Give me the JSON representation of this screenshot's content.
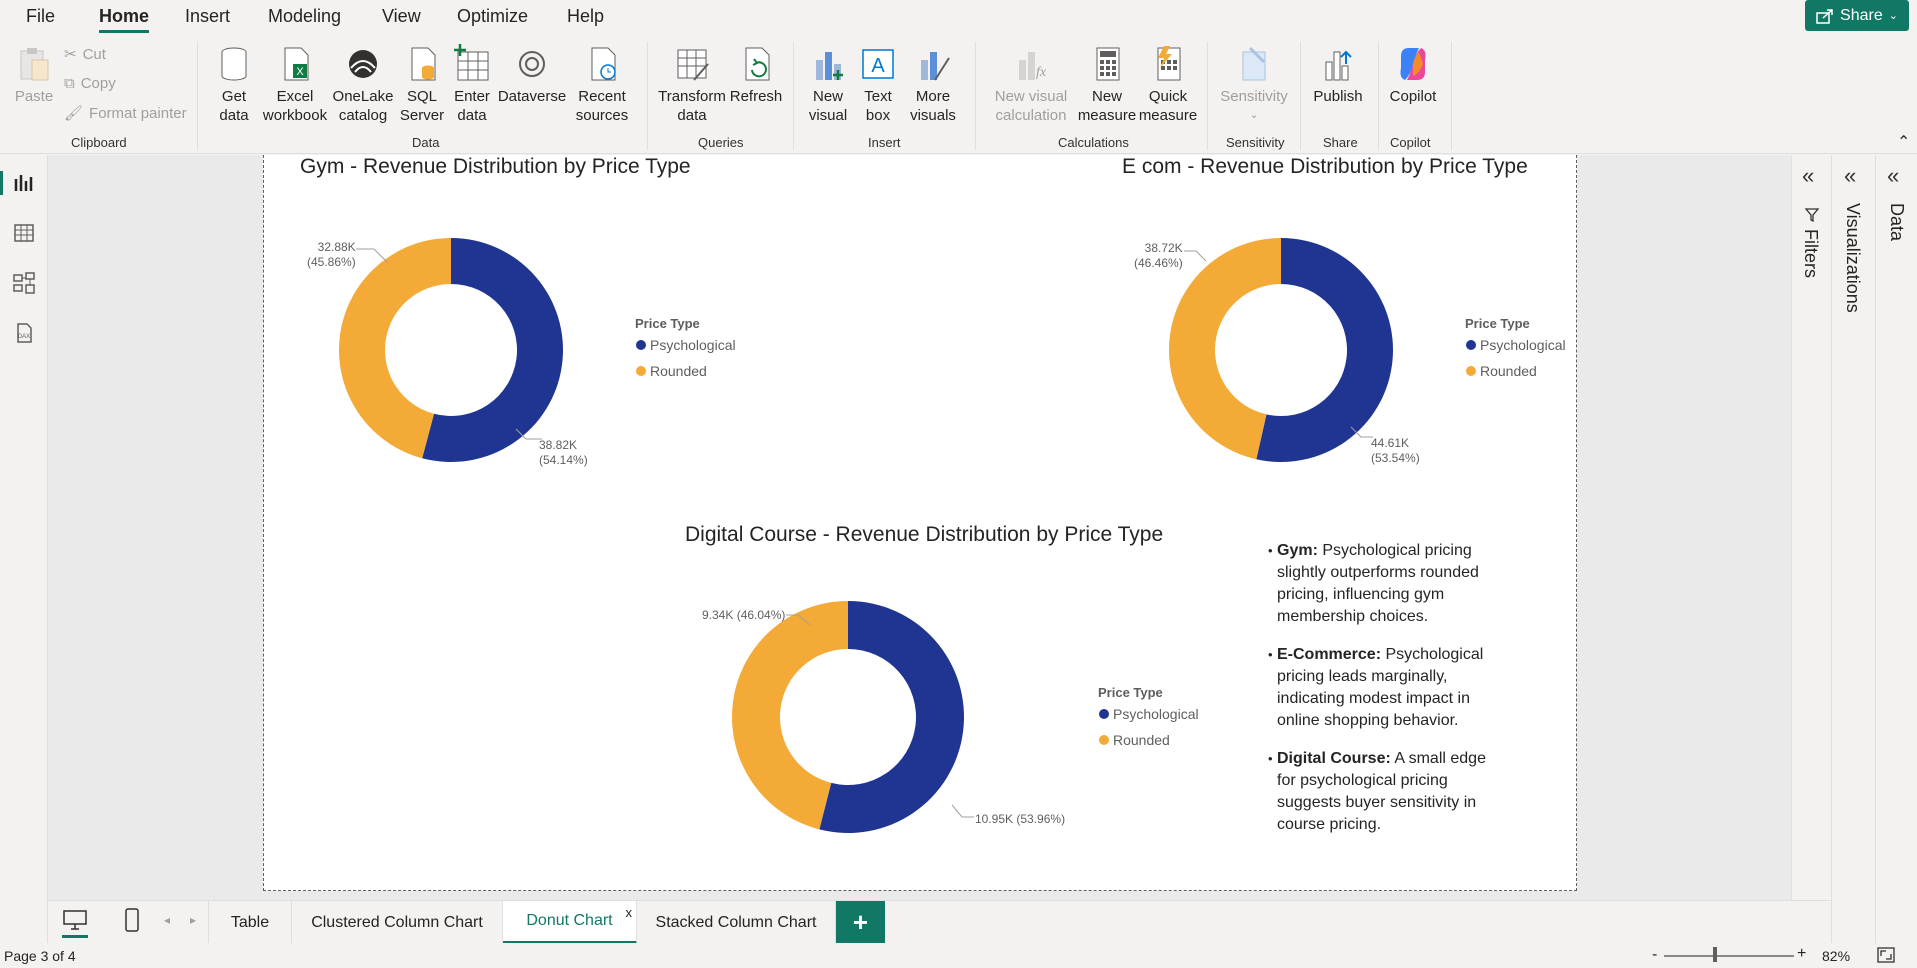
{
  "menu": {
    "items": [
      "File",
      "Home",
      "Insert",
      "Modeling",
      "View",
      "Optimize",
      "Help"
    ],
    "share": "Share"
  },
  "ribbon": {
    "clipboard": {
      "paste": "Paste",
      "cut": "Cut",
      "copy": "Copy",
      "format_painter": "Format painter",
      "group": "Clipboard"
    },
    "data": {
      "get_data": [
        "Get",
        "data"
      ],
      "excel": [
        "Excel",
        "workbook"
      ],
      "onelake": [
        "OneLake",
        "catalog"
      ],
      "sql": [
        "SQL",
        "Server"
      ],
      "enter": [
        "Enter",
        "data"
      ],
      "dataverse": "Dataverse",
      "recent": [
        "Recent",
        "sources"
      ],
      "group": "Data"
    },
    "queries": {
      "transform": [
        "Transform",
        "data"
      ],
      "refresh": "Refresh",
      "group": "Queries"
    },
    "insert": {
      "new_visual": [
        "New",
        "visual"
      ],
      "text_box": [
        "Text",
        "box"
      ],
      "more_visuals": [
        "More",
        "visuals"
      ],
      "group": "Insert"
    },
    "calculations": {
      "new_visual_calc": [
        "New visual",
        "calculation"
      ],
      "new_measure": [
        "New",
        "measure"
      ],
      "quick_measure": [
        "Quick",
        "measure"
      ],
      "group": "Calculations"
    },
    "sensitivity": {
      "label": "Sensitivity",
      "group": "Sensitivity"
    },
    "share": {
      "publish": "Publish",
      "group": "Share"
    },
    "copilot": {
      "label": "Copilot",
      "group": "Copilot"
    }
  },
  "colors": {
    "psychological": "#1f3591",
    "rounded": "#f4aa37",
    "accent": "#117865"
  },
  "charts": {
    "gym": {
      "title": "Gym - Revenue Distribution by Price Type",
      "label_rounded": [
        "32.88K",
        "(45.86%)"
      ],
      "label_psych": [
        "38.82K",
        "(54.14%)"
      ]
    },
    "ecom": {
      "title": "E com - Revenue Distribution by Price Type",
      "label_rounded": [
        "38.72K",
        "(46.46%)"
      ],
      "label_psych": [
        "44.61K",
        "(53.54%)"
      ]
    },
    "digital": {
      "title": "Digital Course - Revenue Distribution by Price Type",
      "label_rounded": "9.34K (46.04%)",
      "label_psych": "10.95K (53.96%)"
    },
    "legend": {
      "title": "Price Type",
      "items": [
        "Psychological",
        "Rounded"
      ]
    }
  },
  "chart_data": [
    {
      "type": "pie",
      "title": "Gym - Revenue Distribution by Price Type",
      "legend_title": "Price Type",
      "categories": [
        "Psychological",
        "Rounded"
      ],
      "values": [
        38.82,
        32.88
      ],
      "percent": [
        54.14,
        45.86
      ],
      "unit": "K"
    },
    {
      "type": "pie",
      "title": "E com - Revenue Distribution by Price Type",
      "legend_title": "Price Type",
      "categories": [
        "Psychological",
        "Rounded"
      ],
      "values": [
        44.61,
        38.72
      ],
      "percent": [
        53.54,
        46.46
      ],
      "unit": "K"
    },
    {
      "type": "pie",
      "title": "Digital Course - Revenue Distribution by Price Type",
      "legend_title": "Price Type",
      "categories": [
        "Psychological",
        "Rounded"
      ],
      "values": [
        10.95,
        9.34
      ],
      "percent": [
        53.96,
        46.04
      ],
      "unit": "K"
    }
  ],
  "insights": [
    {
      "head": "Gym:",
      "text": " Psychological pricing slightly outperforms rounded pricing, influencing gym membership choices."
    },
    {
      "head": "E-Commerce:",
      "text": " Psychological pricing leads marginally, indicating modest impact in online shopping behavior."
    },
    {
      "head": "Digital Course:",
      "text": " A small edge for psychological pricing suggests buyer sensitivity in course pricing."
    }
  ],
  "panes": {
    "filters": "Filters",
    "visualizations": "Visualizations",
    "data": "Data"
  },
  "tabs": {
    "items": [
      "Table",
      "Clustered Column Chart",
      "Donut Chart",
      "Stacked Column Chart"
    ],
    "active": "Donut Chart",
    "close": "x",
    "add": "+"
  },
  "status": {
    "page": "Page 3 of 4",
    "zoom": "82%",
    "zoom_minus": "-",
    "zoom_plus": "+"
  }
}
